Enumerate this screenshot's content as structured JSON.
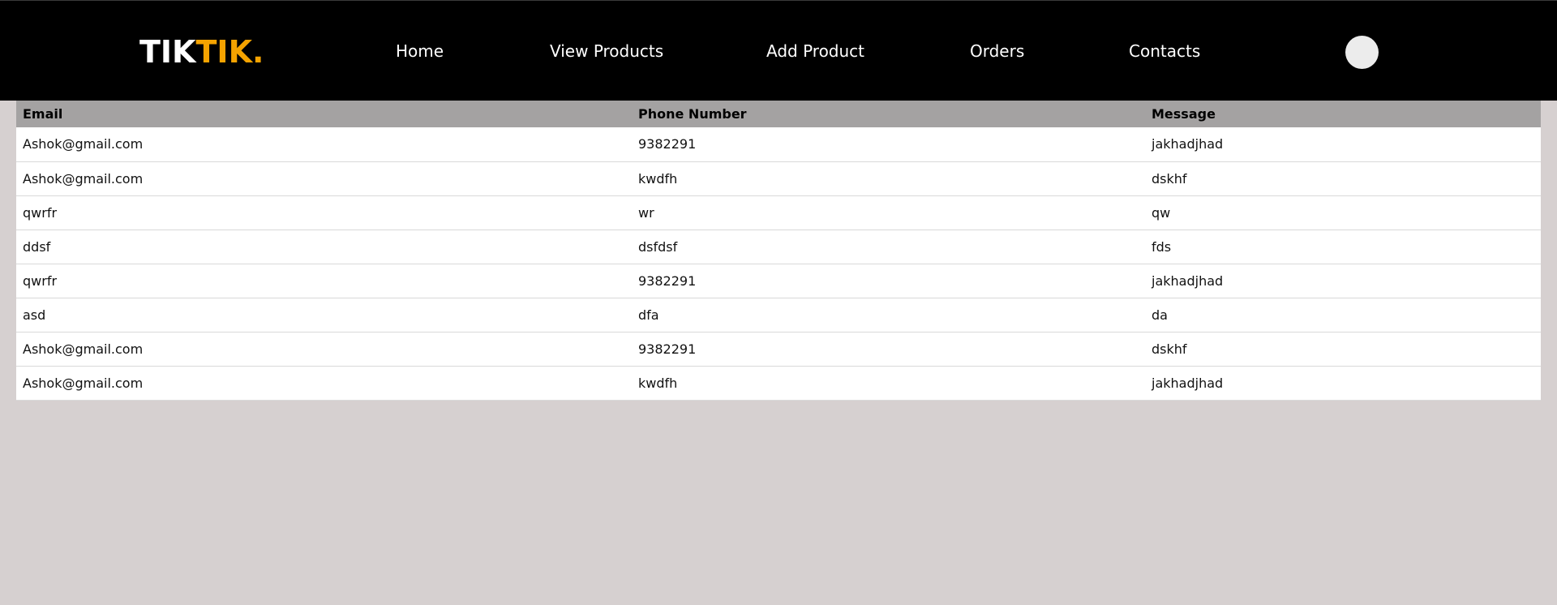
{
  "brand": {
    "logo_part1": "TIK",
    "logo_part2": "TIK.",
    "accent_color": "#f5a300"
  },
  "nav": {
    "items": [
      {
        "label": "Home"
      },
      {
        "label": "View Products"
      },
      {
        "label": "Add Product"
      },
      {
        "label": "Orders"
      },
      {
        "label": "Contacts"
      }
    ],
    "avatar_icon": "user-avatar-icon"
  },
  "table": {
    "columns": [
      "Email",
      "Phone Number",
      "Message"
    ],
    "rows": [
      [
        "Ashok@gmail.com",
        "9382291",
        "jakhadjhad"
      ],
      [
        "Ashok@gmail.com",
        "kwdfh",
        "dskhf"
      ],
      [
        "qwrfr",
        "wr",
        "qw"
      ],
      [
        "ddsf",
        "dsfdsf",
        "fds"
      ],
      [
        "qwrfr",
        "9382291",
        "jakhadjhad"
      ],
      [
        "asd",
        "dfa",
        "da"
      ],
      [
        "Ashok@gmail.com",
        "9382291",
        "dskhf"
      ],
      [
        "Ashok@gmail.com",
        "kwdfh",
        "jakhadjhad"
      ]
    ]
  }
}
